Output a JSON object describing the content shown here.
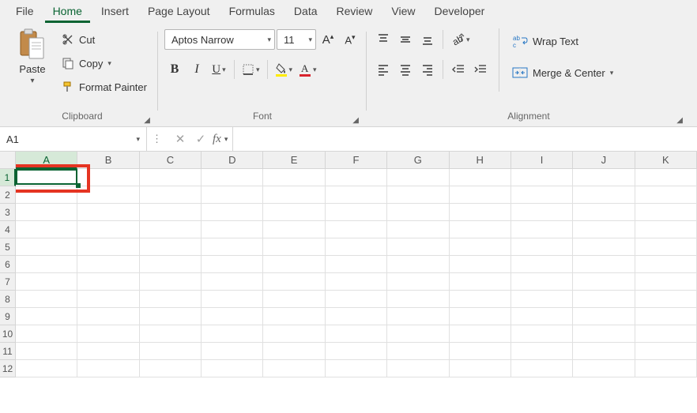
{
  "tabs": [
    "File",
    "Home",
    "Insert",
    "Page Layout",
    "Formulas",
    "Data",
    "Review",
    "View",
    "Developer"
  ],
  "active_tab_index": 1,
  "clipboard": {
    "paste_label": "Paste",
    "cut_label": "Cut",
    "copy_label": "Copy",
    "format_painter_label": "Format Painter",
    "group_label": "Clipboard"
  },
  "font": {
    "font_name": "Aptos Narrow",
    "font_size": "11",
    "group_label": "Font"
  },
  "alignment": {
    "wrap_text_label": "Wrap Text",
    "merge_center_label": "Merge & Center",
    "group_label": "Alignment"
  },
  "namebox": {
    "value": "A1"
  },
  "formula_bar": {
    "value": ""
  },
  "sheet": {
    "columns": [
      "A",
      "B",
      "C",
      "D",
      "E",
      "F",
      "G",
      "H",
      "I",
      "J",
      "K"
    ],
    "rows": [
      "1",
      "2",
      "3",
      "4",
      "5",
      "6",
      "7",
      "8",
      "9",
      "10",
      "11",
      "12"
    ],
    "selected_col_index": 0,
    "selected_row_index": 0
  }
}
